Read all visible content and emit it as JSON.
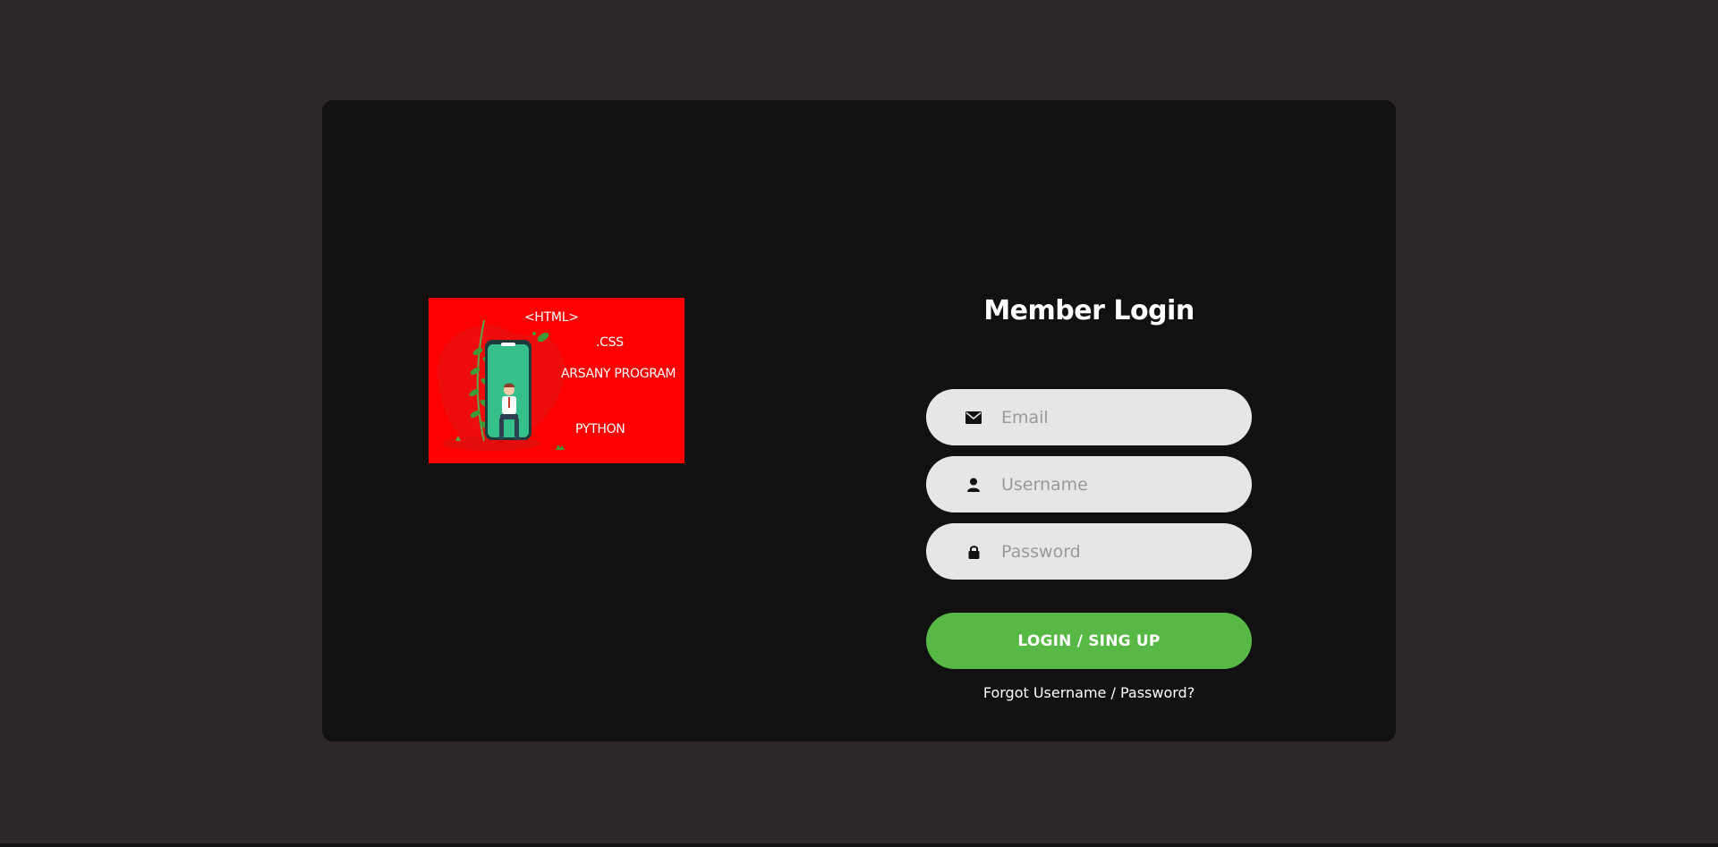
{
  "hero": {
    "texts": {
      "html": "<HTML>",
      "css": ".CSS",
      "arsany": "ARSANY PROGRAM",
      "python": "PYTHON"
    }
  },
  "form": {
    "title": "Member Login",
    "email_placeholder": "Email",
    "username_placeholder": "Username",
    "password_placeholder": "Password",
    "login_label": "LOGIN / SING UP",
    "forgot_label": "Forgot Username / Password?"
  },
  "colors": {
    "page_bg": "#2d2727",
    "card_bg": "#111111",
    "field_bg": "#e6e6e6",
    "accent": "#57b846",
    "hero_bg": "#ff0000"
  },
  "icons": {
    "email": "envelope-icon",
    "username": "user-icon",
    "password": "lock-icon"
  }
}
